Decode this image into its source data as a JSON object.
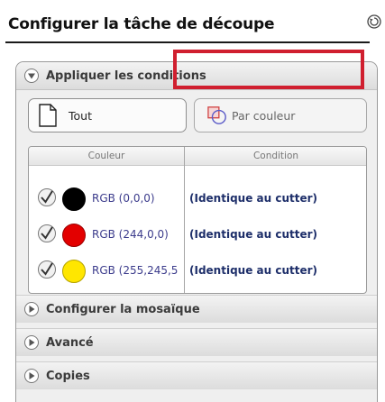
{
  "title": "Configurer la tâche de découpe",
  "icons": {
    "reset": "reset-icon",
    "expanded": "chevron-down-circle-icon",
    "collapsed": "chevron-right-circle-icon",
    "all": "document-icon",
    "by_color": "color-squares-icon",
    "check": "checkbox-checked-icon"
  },
  "colors": {
    "highlight": "#d01f2f"
  },
  "sections": {
    "apply": "Appliquer les conditions",
    "mosaic": "Configurer la mosaïque",
    "advanced": "Avancé",
    "copies": "Copies"
  },
  "buttons": {
    "all": "Tout",
    "by_color": "Par couleur"
  },
  "table": {
    "headers": [
      "Couleur",
      "Condition"
    ],
    "rows": [
      {
        "color": "#000000",
        "rgb": "RGB (0,0,0)",
        "condition": "(Identique au cutter)"
      },
      {
        "color": "#f40000",
        "rgb": "RGB (244,0,0)",
        "condition": "(Identique au cutter)"
      },
      {
        "color": "#fff500",
        "rgb": "RGB (255,245,5",
        "condition": "(Identique au cutter)"
      }
    ]
  }
}
